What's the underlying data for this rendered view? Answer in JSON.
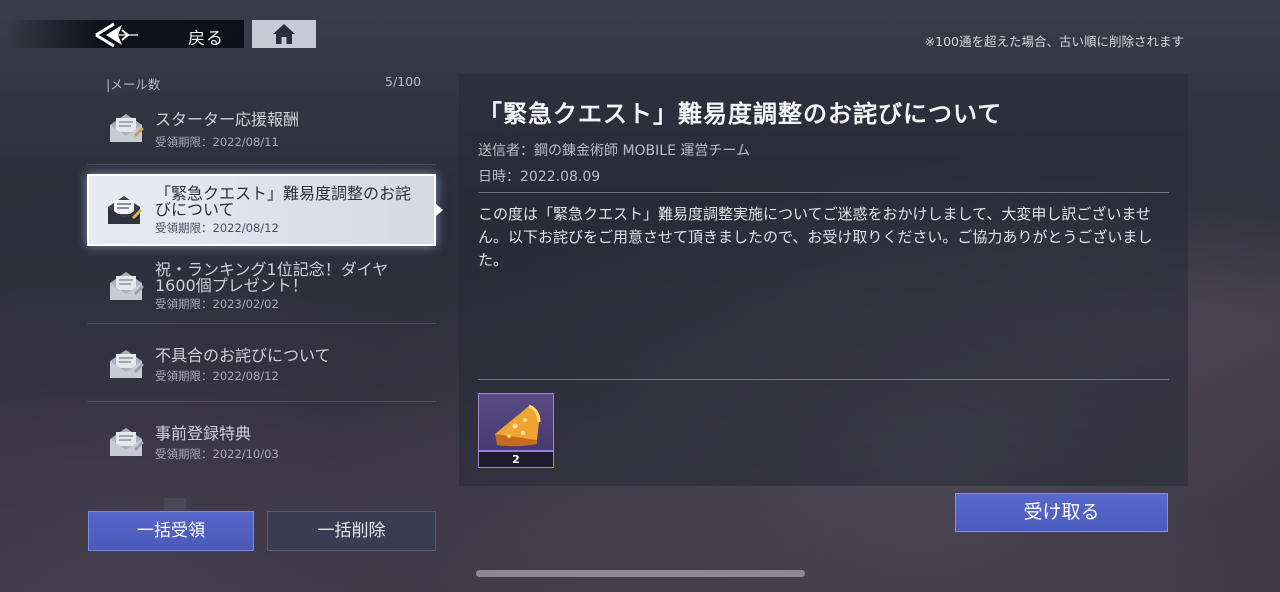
{
  "header": {
    "back_label": "戻る",
    "back_icon": "back-arrow-icon",
    "home_icon": "home-icon",
    "notice": "※100通を超えた場合、古い順に削除されます"
  },
  "mailbox": {
    "count_label": "|メール数",
    "count_value": "5/100",
    "items": [
      {
        "title": "スターター応援報酬",
        "deadline": "受領期限：2022/08/11",
        "selected": false
      },
      {
        "title": "「緊急クエスト」難易度調整のお詫びについて",
        "deadline": "受領期限：2022/08/12",
        "selected": true
      },
      {
        "title": "祝・ランキング1位記念！ダイヤ1600個プレゼント！",
        "deadline": "受領期限：2023/02/02",
        "selected": false
      },
      {
        "title": "不具合のお詫びについて",
        "deadline": "受領期限：2022/08/12",
        "selected": false
      },
      {
        "title": "事前登録特典",
        "deadline": "受領期限：2022/10/03",
        "selected": false
      }
    ],
    "bulk_receive_label": "一括受領",
    "bulk_delete_label": "一括削除"
  },
  "detail": {
    "title": "「緊急クエスト」難易度調整のお詫びについて",
    "sender": "送信者：鋼の錬金術師 MOBILE 運営チーム",
    "date": "日時：2022.08.09",
    "body": "この度は「緊急クエスト」難易度調整実施についてご迷惑をおかけしまして、大変申し訳ございません。以下お詫びをご用意させて頂きましたので、お受け取りください。ご協力ありがとうございました。",
    "reward": {
      "icon": "cake-slice-icon",
      "quantity": "2"
    },
    "receive_label": "受け取る"
  },
  "colors": {
    "accent": "#4f5fc2",
    "selected_bg": "#e3e6ee",
    "reward_frame": "#9a86d6"
  }
}
